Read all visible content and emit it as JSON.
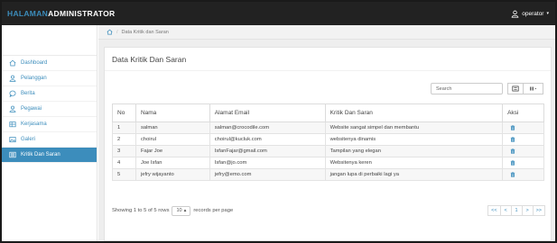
{
  "navbar": {
    "brand_part1": "HALAMAN",
    "brand_part2": "ADMINISTRATOR",
    "user_label": "operator",
    "caret": "▾"
  },
  "sidebar": {
    "items": [
      {
        "label": "Dashboard",
        "icon": "home-icon"
      },
      {
        "label": "Pelanggan",
        "icon": "user-icon"
      },
      {
        "label": "Berita",
        "icon": "chat-icon"
      },
      {
        "label": "Pegawai",
        "icon": "user-icon"
      },
      {
        "label": "Kerjasama",
        "icon": "handshake-icon"
      },
      {
        "label": "Galeri",
        "icon": "image-icon"
      },
      {
        "label": "Kritik Dan Saran",
        "icon": "list-icon",
        "active": true
      }
    ]
  },
  "breadcrumb": {
    "separator": "/",
    "current": "Data Kritik dan Saran"
  },
  "panel": {
    "title": "Data Kritik Dan Saran"
  },
  "search": {
    "placeholder": "Search"
  },
  "table": {
    "headers": [
      "No",
      "Nama",
      "Alamat Email",
      "Kritik Dan Saran",
      "Aksi"
    ],
    "rows": [
      {
        "no": "1",
        "nama": "salman",
        "email": "salman@crocodile.com",
        "kritik": "Website sangat simpel dan membantu"
      },
      {
        "no": "2",
        "nama": "choirul",
        "email": "choirul@kucluk.com",
        "kritik": "websitenya dinamis"
      },
      {
        "no": "3",
        "nama": "Fajar Joe",
        "email": "IsfanFajar@gmail.com",
        "kritik": "Tampilan yang elegan"
      },
      {
        "no": "4",
        "nama": "Joe Isfan",
        "email": "Isfan@jo.com",
        "kritik": "Websitenya keren"
      },
      {
        "no": "5",
        "nama": "jefry wijayanto",
        "email": "jefry@emo.com",
        "kritik": "jangan lupa di perbaiki lagi ya"
      }
    ]
  },
  "footer": {
    "showing": "Showing 1 to 5 of 5 rows",
    "per_page": "10",
    "per_page_caret": "▴",
    "records_per_page": "records per page",
    "pager": [
      "<<",
      "<",
      "1",
      ">",
      ">>"
    ]
  },
  "colors": {
    "accent": "#3c8dbc",
    "navbar_bg": "#222222",
    "delete_icon": "#3c8dbc"
  }
}
